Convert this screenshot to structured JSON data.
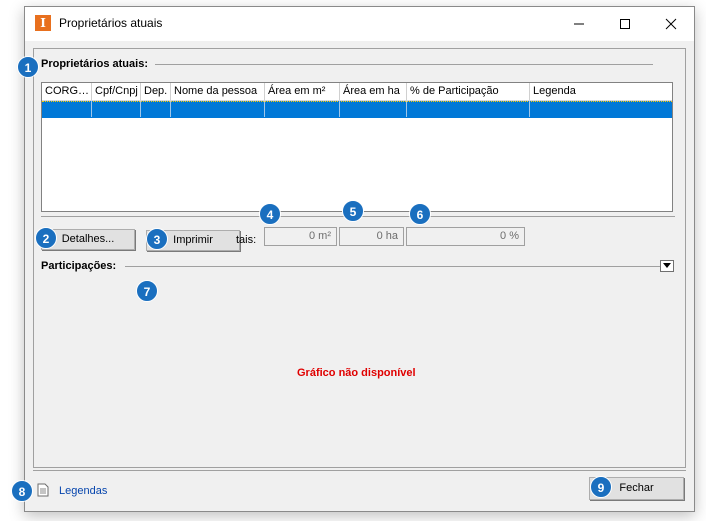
{
  "window": {
    "title": "Proprietários atuais",
    "app_icon_letter": "I"
  },
  "owners_section": {
    "title": "Proprietários atuais:"
  },
  "table": {
    "columns": [
      "CORG…",
      "Cpf/Cnpj",
      "Dep.",
      "Nome da pessoa",
      "Área em m²",
      "Área em ha",
      "% de Participação",
      "Legenda"
    ],
    "rows": [
      [
        "",
        "",
        "",
        "",
        "",
        "",
        "",
        ""
      ]
    ]
  },
  "buttons": {
    "details": "Detalhes...",
    "print": "Imprimir",
    "close": "Fechar"
  },
  "totals": {
    "label": "tais:",
    "area_m2": "0 m²",
    "area_ha": "0 ha",
    "participation": "0 %"
  },
  "participations_section": {
    "title": "Participações:",
    "no_chart": "Gráfico não disponível"
  },
  "footer": {
    "legend_link": "Legendas"
  },
  "callouts": [
    "1",
    "2",
    "3",
    "4",
    "5",
    "6",
    "7",
    "8",
    "9"
  ],
  "colors": {
    "accent": "#0078d7",
    "callout": "#1a6fbf",
    "error": "#e00000",
    "app_icon": "#e8701e"
  }
}
